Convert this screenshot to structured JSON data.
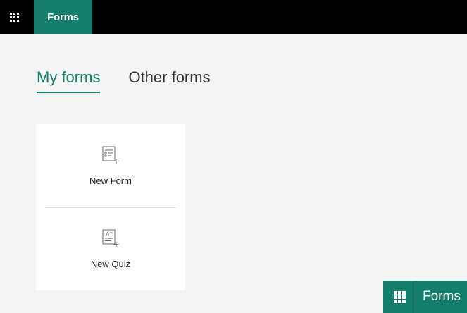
{
  "header": {
    "app_launcher_icon": "waffle-grid-icon",
    "app_name": "Forms"
  },
  "tabs": [
    {
      "label": "My forms",
      "active": true
    },
    {
      "label": "Other forms",
      "active": false
    }
  ],
  "create_card": {
    "new_form": {
      "label": "New Form",
      "icon": "new-form-icon"
    },
    "new_quiz": {
      "label": "New Quiz",
      "icon": "new-quiz-icon"
    }
  },
  "mini_bar": {
    "app_launcher_icon": "waffle-grid-icon",
    "app_name": "Forms"
  },
  "colors": {
    "accent": "#127e6b",
    "topbar": "#000000",
    "background": "#f4f4f4",
    "card": "#ffffff"
  }
}
